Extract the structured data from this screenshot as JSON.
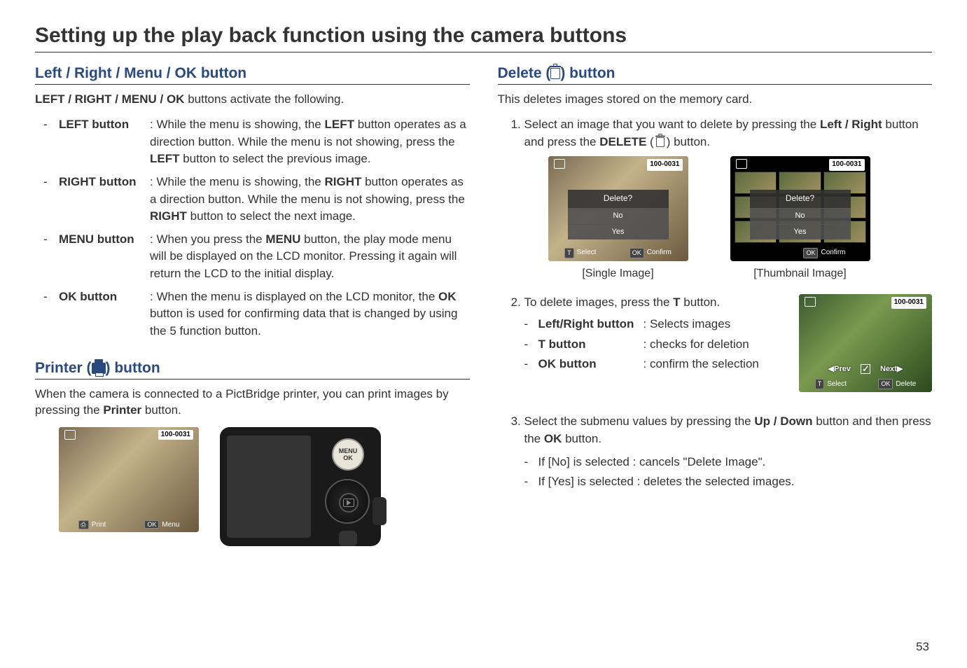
{
  "title": "Setting up the play back function using the camera buttons",
  "left": {
    "sec1_title": "Left / Right / Menu / OK button",
    "lead": "LEFT / RIGHT / MENU / OK buttons activate the following.",
    "left_btn_label": "LEFT button",
    "left_btn_desc_a": ": While the menu is showing, the ",
    "left_btn_bold": "LEFT",
    "left_btn_desc_b": " button operates as a direction button. While the menu is not showing, press the ",
    "left_btn_bold2": "LEFT",
    "left_btn_desc_c": " button to select the previous image.",
    "right_btn_label": "RIGHT button",
    "right_btn_desc_a": ": While the menu is showing, the ",
    "right_btn_bold": "RIGHT",
    "right_btn_desc_b": " button operates as a direction button. While the menu is not showing, press the ",
    "right_btn_bold2": "RIGHT",
    "right_btn_desc_c": " button to select the next image.",
    "menu_btn_label": "MENU button",
    "menu_btn_desc_a": ": When you press the ",
    "menu_btn_bold": "MENU",
    "menu_btn_desc_b": " button, the play mode menu will be displayed on the LCD monitor. Pressing it again will return the LCD to the initial display.",
    "ok_btn_label": "OK button",
    "ok_btn_desc_a": ": When the menu is displayed on the LCD monitor, the ",
    "ok_btn_bold": "OK",
    "ok_btn_desc_b": " button is used for confirming data that is changed by using the 5 function button.",
    "sec2_title_a": "Printer (",
    "sec2_title_b": ") button",
    "printer_lead_a": "When the camera is connected to a PictBridge printer, you can print images by pressing the ",
    "printer_bold": "Printer",
    "printer_lead_b": " button.",
    "lcd_tag": "100-0031",
    "lcd_print": "Print",
    "lcd_ok": "OK",
    "lcd_menu": "Menu",
    "cam_menu": "MENU",
    "cam_ok": "OK"
  },
  "right": {
    "sec1_title_a": "Delete (",
    "sec1_title_b": ") button",
    "lead": "This deletes images stored on the memory card.",
    "step1_a": "Select an image that you want to delete by pressing the ",
    "step1_bold": "Left / Right",
    "step1_b": " button and press the ",
    "step1_bold2": "DELETE",
    "step1_c": " (",
    "step1_d": ") button.",
    "dlg_q": "Delete?",
    "dlg_no": "No",
    "dlg_yes": "Yes",
    "bb_t": "T",
    "bb_select": "Select",
    "bb_ok": "OK",
    "bb_confirm": "Confirm",
    "bb_delete": "Delete",
    "cap_single": "[Single Image]",
    "cap_thumb": "[Thumbnail Image]",
    "step2_a": "To delete images, press the ",
    "step2_bold": "T",
    "step2_b": " button.",
    "s2_lr_label": "Left/Right button",
    "s2_lr_desc": ": Selects images",
    "s2_t_label": "T button",
    "s2_t_desc": ": checks for deletion",
    "s2_ok_label": "OK button",
    "s2_ok_desc": ": confirm the selection",
    "prev": "Prev",
    "next": "Next",
    "step3_a": "Select the submenu values by pressing the ",
    "step3_bold": "Up / Down",
    "step3_b": " button and then press the ",
    "step3_bold2": "OK",
    "step3_c": " button.",
    "s3_no": "If [No] is selected   : cancels \"Delete Image\".",
    "s3_yes": "If [Yes] is selected  : deletes the selected images."
  },
  "page_num": "53"
}
